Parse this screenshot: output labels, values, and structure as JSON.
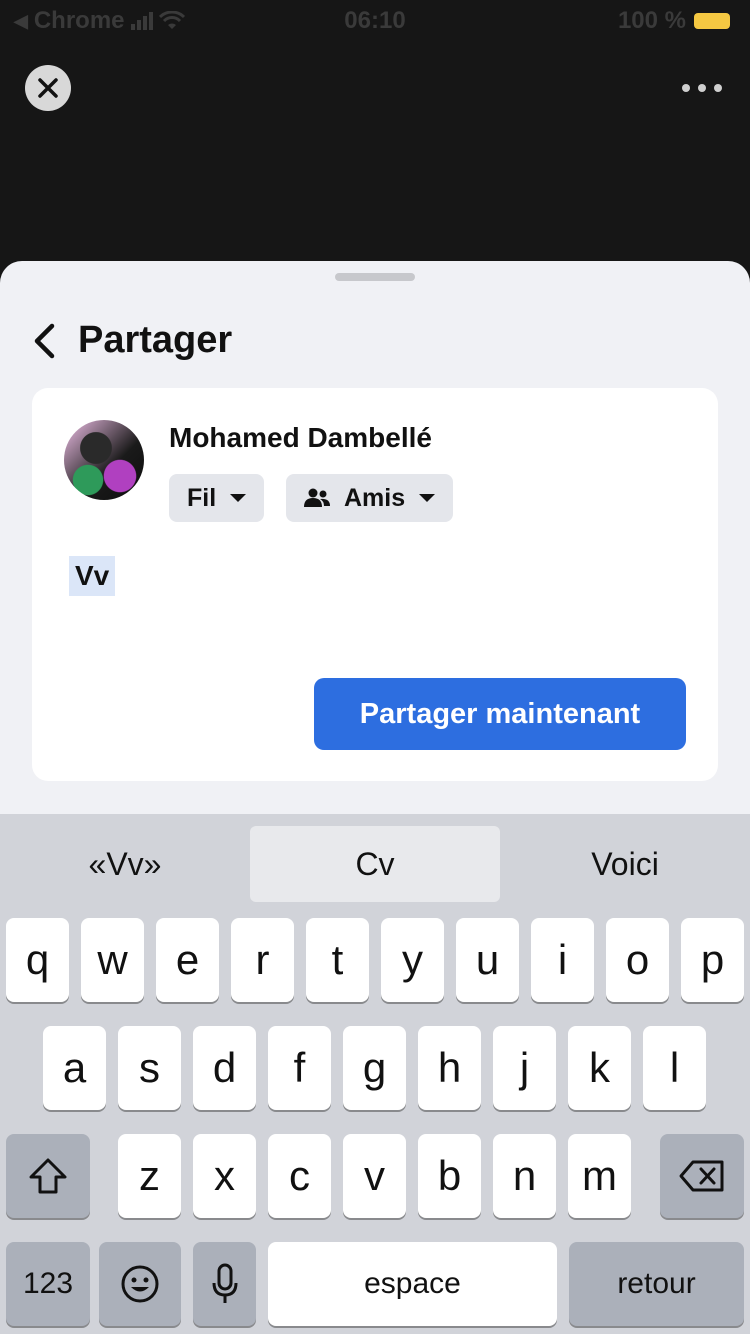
{
  "status_bar": {
    "back_app": "Chrome",
    "time": "06:10",
    "battery": "100 %"
  },
  "sheet": {
    "title": "Partager",
    "user_name": "Mohamed Dambellé",
    "audience_chip": "Fil",
    "privacy_chip": "Amis",
    "post_text": "Vv",
    "share_button": "Partager maintenant"
  },
  "keyboard": {
    "suggestions": [
      "«Vv»",
      "Cv",
      "Voici"
    ],
    "row1": [
      "q",
      "w",
      "e",
      "r",
      "t",
      "y",
      "u",
      "i",
      "o",
      "p"
    ],
    "row2": [
      "a",
      "s",
      "d",
      "f",
      "g",
      "h",
      "j",
      "k",
      "l"
    ],
    "row3": [
      "z",
      "x",
      "c",
      "v",
      "b",
      "n",
      "m"
    ],
    "numbers_key": "123",
    "space_key": "espace",
    "return_key": "retour"
  },
  "icons": {
    "close": "close-icon",
    "more": "more-horizontal-icon",
    "back": "chevron-left-icon",
    "friends": "friends-icon",
    "shift": "shift-icon",
    "backspace": "backspace-icon",
    "emoji": "emoji-icon",
    "mic": "microphone-icon"
  },
  "colors": {
    "primary": "#2d6ee0",
    "battery": "#f5c842",
    "selection": "#dbe6f8"
  }
}
